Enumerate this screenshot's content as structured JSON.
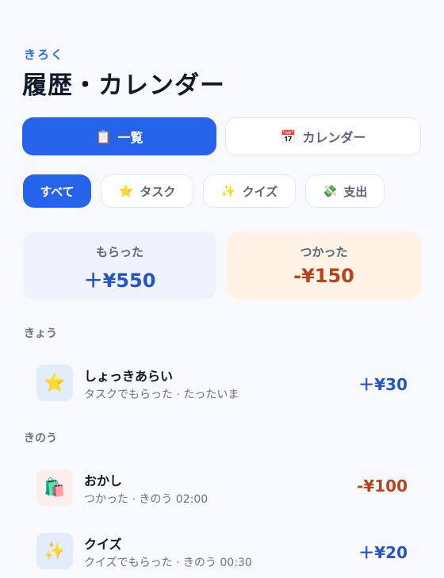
{
  "header": {
    "kicker": "きろく",
    "title": "履歴・カレンダー"
  },
  "view_tabs": [
    {
      "icon": "clipboard-icon",
      "glyph": "📋",
      "label": "一覧",
      "active": true
    },
    {
      "icon": "calendar-icon",
      "glyph": "📅",
      "label": "カレンダー",
      "active": false
    }
  ],
  "filters": [
    {
      "label": "すべて",
      "active": true
    },
    {
      "icon": "star-icon",
      "glyph": "⭐",
      "label": "タスク",
      "active": false
    },
    {
      "icon": "sparkles-icon",
      "glyph": "✨",
      "label": "クイズ",
      "active": false
    },
    {
      "icon": "money-icon",
      "glyph": "💸",
      "label": "支出",
      "active": false
    }
  ],
  "summary": {
    "received": {
      "label": "もらった",
      "amount": "＋¥550"
    },
    "spent": {
      "label": "つかった",
      "amount": "-¥150"
    }
  },
  "groups": [
    {
      "day": "きょう",
      "items": [
        {
          "icon": "star-icon",
          "glyph": "⭐",
          "name": "しょっきあらい",
          "sub": "タスクでもらった · たったいま",
          "amount": "＋¥30",
          "kind": "plus"
        }
      ]
    },
    {
      "day": "きのう",
      "items": [
        {
          "icon": "shopping-bags-icon",
          "glyph": "🛍️",
          "name": "おかし",
          "sub": "つかった · きのう 02:00",
          "amount": "-¥100",
          "kind": "minus"
        },
        {
          "icon": "sparkles-icon",
          "glyph": "✨",
          "name": "クイズ",
          "sub": "クイズでもらった · きのう 00:30",
          "amount": "＋¥20",
          "kind": "plus"
        }
      ]
    }
  ],
  "colors": {
    "accent": "#2563eb",
    "plus": "#2554c7",
    "minus": "#b8431a",
    "income_card": "#eef3fd",
    "expense_card": "#fff3e6",
    "icon_bg_plus": "#e3ecfb",
    "icon_bg_minus": "#fdeeee"
  }
}
